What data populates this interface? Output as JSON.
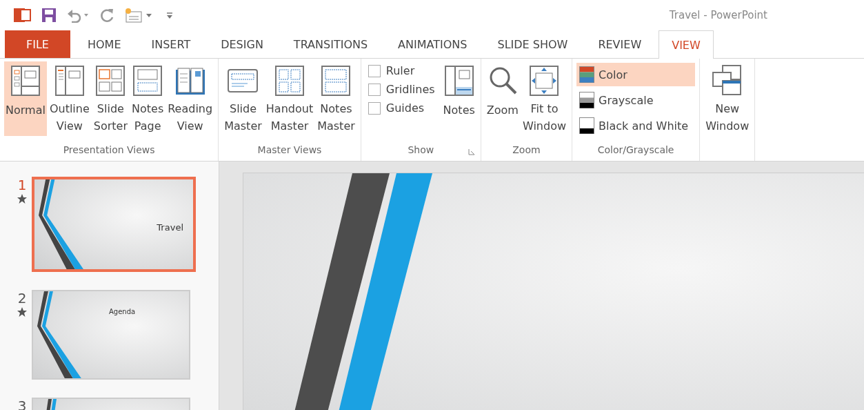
{
  "window": {
    "title": "Travel - PowerPoint"
  },
  "tabs": [
    {
      "label": "FILE",
      "kind": "file",
      "selected": false
    },
    {
      "label": "HOME",
      "kind": "tab",
      "selected": false
    },
    {
      "label": "INSERT",
      "kind": "tab",
      "selected": false
    },
    {
      "label": "DESIGN",
      "kind": "tab",
      "selected": false
    },
    {
      "label": "TRANSITIONS",
      "kind": "tab",
      "selected": false
    },
    {
      "label": "ANIMATIONS",
      "kind": "tab",
      "selected": false
    },
    {
      "label": "SLIDE SHOW",
      "kind": "tab",
      "selected": false
    },
    {
      "label": "REVIEW",
      "kind": "tab",
      "selected": false
    },
    {
      "label": "VIEW",
      "kind": "tab",
      "selected": true
    }
  ],
  "ribbon": {
    "groups": [
      {
        "title": "Presentation Views",
        "items": [
          {
            "kind": "large",
            "label": "Normal",
            "selected": true
          },
          {
            "kind": "large",
            "label": "Outline\nView",
            "selected": false
          },
          {
            "kind": "large",
            "label": "Slide\nSorter",
            "selected": false
          },
          {
            "kind": "large",
            "label": "Notes\nPage",
            "selected": false
          },
          {
            "kind": "large",
            "label": "Reading\nView",
            "selected": false
          }
        ]
      },
      {
        "title": "Master Views",
        "items": [
          {
            "kind": "large",
            "label": "Slide\nMaster",
            "selected": false
          },
          {
            "kind": "large",
            "label": "Handout\nMaster",
            "selected": false
          },
          {
            "kind": "large",
            "label": "Notes\nMaster",
            "selected": false
          }
        ]
      },
      {
        "title": "Show",
        "launcher": true,
        "items": [
          {
            "kind": "checks",
            "options": [
              {
                "label": "Ruler",
                "checked": false
              },
              {
                "label": "Gridlines",
                "checked": false
              },
              {
                "label": "Guides",
                "checked": false
              }
            ]
          },
          {
            "kind": "large",
            "label": "Notes",
            "selected": false
          }
        ]
      },
      {
        "title": "Zoom",
        "items": [
          {
            "kind": "large",
            "label": "Zoom",
            "selected": false
          },
          {
            "kind": "large",
            "label": "Fit to\nWindow",
            "selected": false
          }
        ]
      },
      {
        "title": "Color/Grayscale",
        "items": [
          {
            "kind": "small",
            "options": [
              {
                "label": "Color",
                "selected": true
              },
              {
                "label": "Grayscale",
                "selected": false
              },
              {
                "label": "Black and White",
                "selected": false
              }
            ]
          }
        ]
      },
      {
        "items": [
          {
            "kind": "large",
            "label": "New\nWindow",
            "selected": false
          }
        ]
      }
    ]
  },
  "slides": [
    {
      "number": "1",
      "title": "Travel",
      "selected": true
    },
    {
      "number": "2",
      "title": "Agenda",
      "selected": false
    },
    {
      "number": "3",
      "selected": false
    }
  ]
}
